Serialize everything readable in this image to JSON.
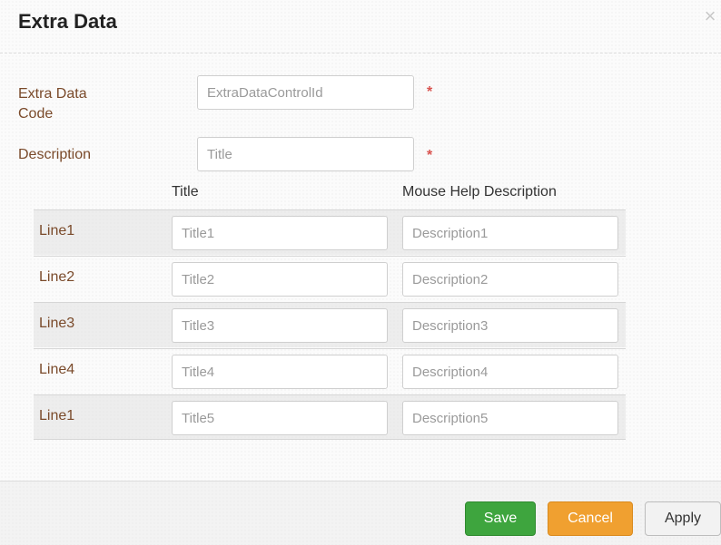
{
  "dialog": {
    "title": "Extra Data",
    "close_glyph": "×"
  },
  "form": {
    "code_label_line1": "Extra Data",
    "code_label_line2": "Code",
    "code_placeholder": "ExtraDataControlId",
    "description_label": "Description",
    "description_placeholder": "Title",
    "required_marker": "*"
  },
  "table": {
    "col_title": "Title",
    "col_description": "Mouse Help Description",
    "rows": [
      {
        "label": "Line1",
        "title_placeholder": "Title1",
        "desc_placeholder": "Description1"
      },
      {
        "label": "Line2",
        "title_placeholder": "Title2",
        "desc_placeholder": "Description2"
      },
      {
        "label": "Line3",
        "title_placeholder": "Title3",
        "desc_placeholder": "Description3"
      },
      {
        "label": "Line4",
        "title_placeholder": "Title4",
        "desc_placeholder": "Description4"
      },
      {
        "label": "Line1",
        "title_placeholder": "Title5",
        "desc_placeholder": "Description5"
      }
    ]
  },
  "footer": {
    "save_label": "Save",
    "cancel_label": "Cancel",
    "apply_label": "Apply"
  },
  "colors": {
    "save": "#3ea53e",
    "cancel": "#f0a030",
    "required": "#d9534f",
    "label": "#7a4a2a"
  },
  "icons": {
    "close": "close-icon"
  }
}
